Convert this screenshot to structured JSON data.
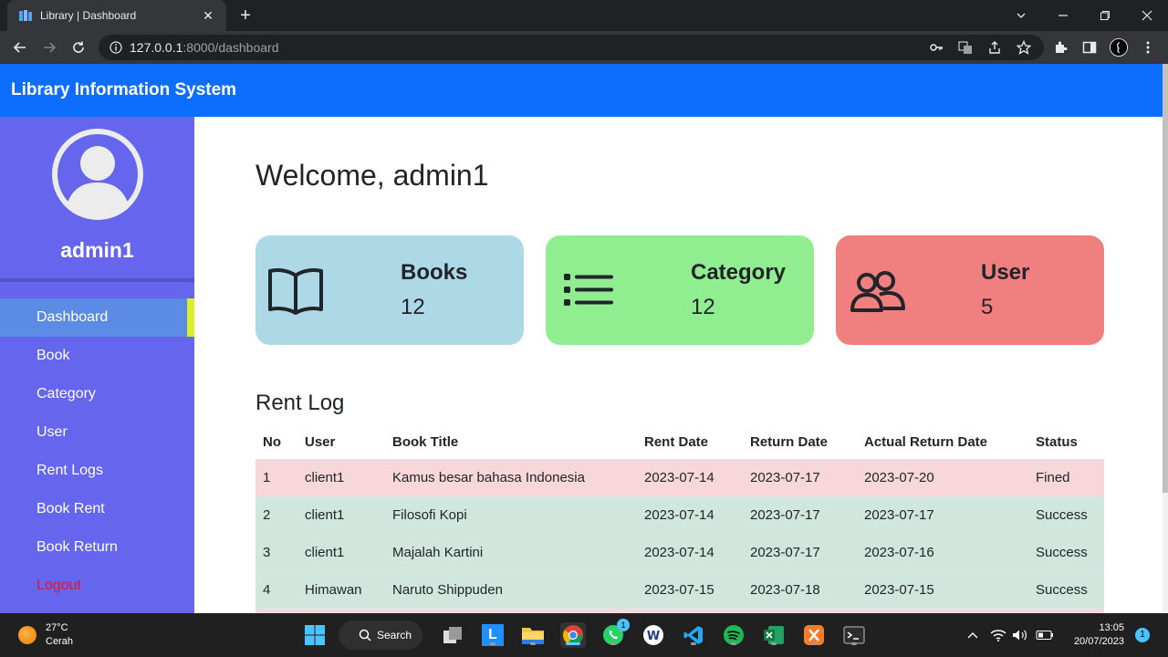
{
  "browser": {
    "tab_title": "Library | Dashboard",
    "url_host": "127.0.0.1",
    "url_path": ":8000/dashboard"
  },
  "app": {
    "brand": "Library Information System"
  },
  "sidebar": {
    "username": "admin1",
    "items": [
      {
        "label": "Dashboard",
        "active": true
      },
      {
        "label": "Book"
      },
      {
        "label": "Category"
      },
      {
        "label": "User"
      },
      {
        "label": "Rent Logs"
      },
      {
        "label": "Book Rent"
      },
      {
        "label": "Book Return"
      },
      {
        "label": "Logout"
      }
    ]
  },
  "main": {
    "welcome": "Welcome, admin1",
    "cards": [
      {
        "title": "Books",
        "value": "12",
        "color": "#add8e6",
        "icon": "book-icon"
      },
      {
        "title": "Category",
        "value": "12",
        "color": "#90ee90",
        "icon": "list-icon"
      },
      {
        "title": "User",
        "value": "5",
        "color": "#f08080",
        "icon": "users-icon"
      }
    ],
    "rent_log": {
      "title": "Rent Log",
      "headers": [
        "No",
        "User",
        "Book Title",
        "Rent Date",
        "Return Date",
        "Actual Return Date",
        "Status"
      ],
      "rows": [
        [
          "1",
          "client1",
          "Kamus besar bahasa Indonesia",
          "2023-07-14",
          "2023-07-17",
          "2023-07-20",
          "Fined"
        ],
        [
          "2",
          "client1",
          "Filosofi Kopi",
          "2023-07-14",
          "2023-07-17",
          "2023-07-17",
          "Success"
        ],
        [
          "3",
          "client1",
          "Majalah Kartini",
          "2023-07-14",
          "2023-07-17",
          "2023-07-16",
          "Success"
        ],
        [
          "4",
          "Himawan",
          "Naruto Shippuden",
          "2023-07-15",
          "2023-07-18",
          "2023-07-15",
          "Success"
        ]
      ]
    }
  },
  "taskbar": {
    "temperature": "27°C",
    "weather": "Cerah",
    "search_label": "Search",
    "whatsapp_badge": "1",
    "time": "13:05",
    "date": "20/07/2023",
    "notifications": "1"
  }
}
